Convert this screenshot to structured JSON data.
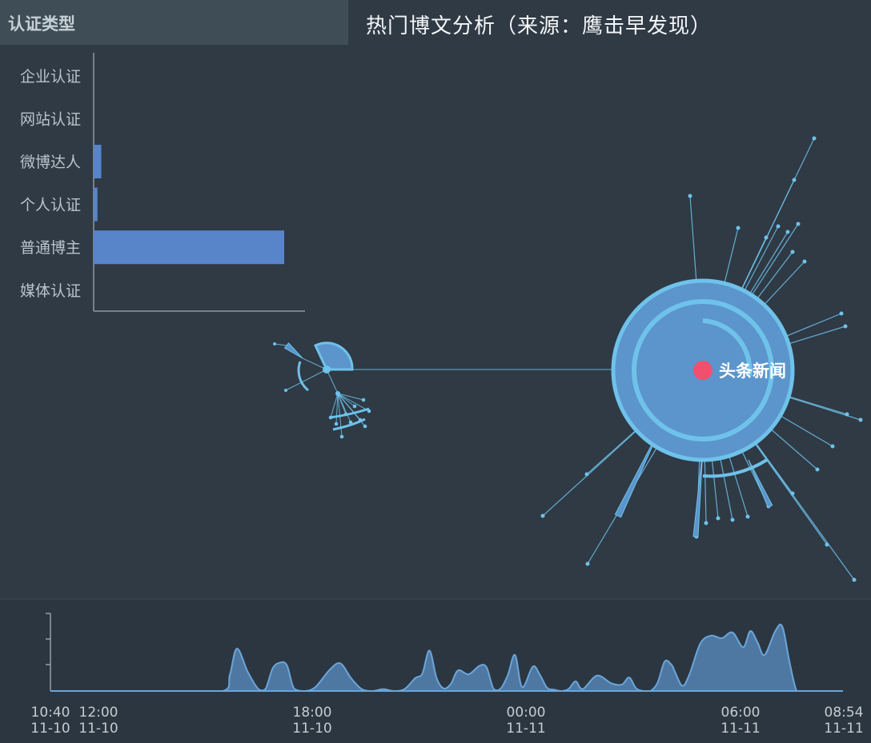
{
  "panel": {
    "title": "认证类型"
  },
  "main_title": "热门博文分析（来源：鹰击早发现）",
  "graph": {
    "center_label": "头条新闻",
    "center_color": "#f0506e",
    "node_color": "#5b95cc",
    "edge_color": "#6fc2ea"
  },
  "chart_data": [
    {
      "type": "bar",
      "orientation": "horizontal",
      "title": "认证类型",
      "categories": [
        "企业认证",
        "网站认证",
        "微博达人",
        "个人认证",
        "普通博主",
        "媒体认证"
      ],
      "values": [
        0,
        0,
        4,
        2,
        100,
        0
      ],
      "xlim": [
        0,
        100
      ],
      "bar_color": "#5885ca"
    },
    {
      "type": "area",
      "x_ticks": [
        "10:40\n11-10",
        "12:00\n11-10",
        "18:00\n11-10",
        "00:00\n11-11",
        "06:00\n11-11",
        "08:54\n11-11"
      ],
      "x_start_hours": 10.667,
      "x_end_hours": 32.9,
      "ylim": [
        0,
        10
      ],
      "color": "#5a8fc3",
      "x": [
        10.67,
        12.0,
        14.0,
        15.5,
        15.7,
        15.9,
        16.2,
        16.5,
        16.7,
        16.9,
        17.1,
        17.3,
        17.5,
        17.8,
        18.1,
        18.5,
        18.8,
        19.1,
        19.4,
        19.7,
        20.0,
        20.3,
        20.6,
        20.9,
        21.1,
        21.3,
        21.5,
        21.7,
        21.9,
        22.1,
        22.4,
        22.7,
        22.9,
        23.1,
        23.3,
        23.5,
        23.7,
        23.9,
        24.2,
        24.4,
        24.6,
        24.8,
        25.0,
        25.2,
        25.4,
        25.6,
        26.0,
        26.4,
        26.7,
        26.9,
        27.1,
        27.3,
        27.5,
        27.7,
        27.9,
        28.1,
        28.2,
        28.4,
        28.6,
        28.9,
        29.2,
        29.5,
        29.8,
        30.1,
        30.3,
        30.5,
        30.7,
        31.0,
        31.2,
        31.4,
        31.6,
        31.8,
        32.0,
        32.2,
        32.4,
        32.6,
        32.8,
        32.9
      ],
      "values": [
        0,
        0,
        0,
        0,
        2.5,
        6.6,
        3.0,
        0.3,
        0.3,
        3.5,
        4.4,
        4.0,
        0.4,
        0,
        0.6,
        3.3,
        4.3,
        2.0,
        0.3,
        0,
        0.3,
        0,
        0.3,
        2.0,
        2.7,
        6.3,
        2.0,
        0.4,
        1.1,
        3.2,
        2.6,
        3.9,
        3.7,
        0.3,
        0.4,
        2.5,
        5.6,
        0.6,
        3.8,
        2.5,
        0.5,
        0.2,
        0,
        0.3,
        1.5,
        0.3,
        2.4,
        1.2,
        1.0,
        2.1,
        0.4,
        0,
        0,
        1.3,
        4.6,
        4.0,
        2.8,
        0.8,
        2.7,
        7.4,
        8.6,
        8.2,
        9.1,
        6.8,
        9.3,
        7.6,
        5.6,
        9.3,
        10.0,
        4.5,
        0,
        0,
        0,
        0,
        0,
        0,
        0,
        0
      ]
    }
  ]
}
